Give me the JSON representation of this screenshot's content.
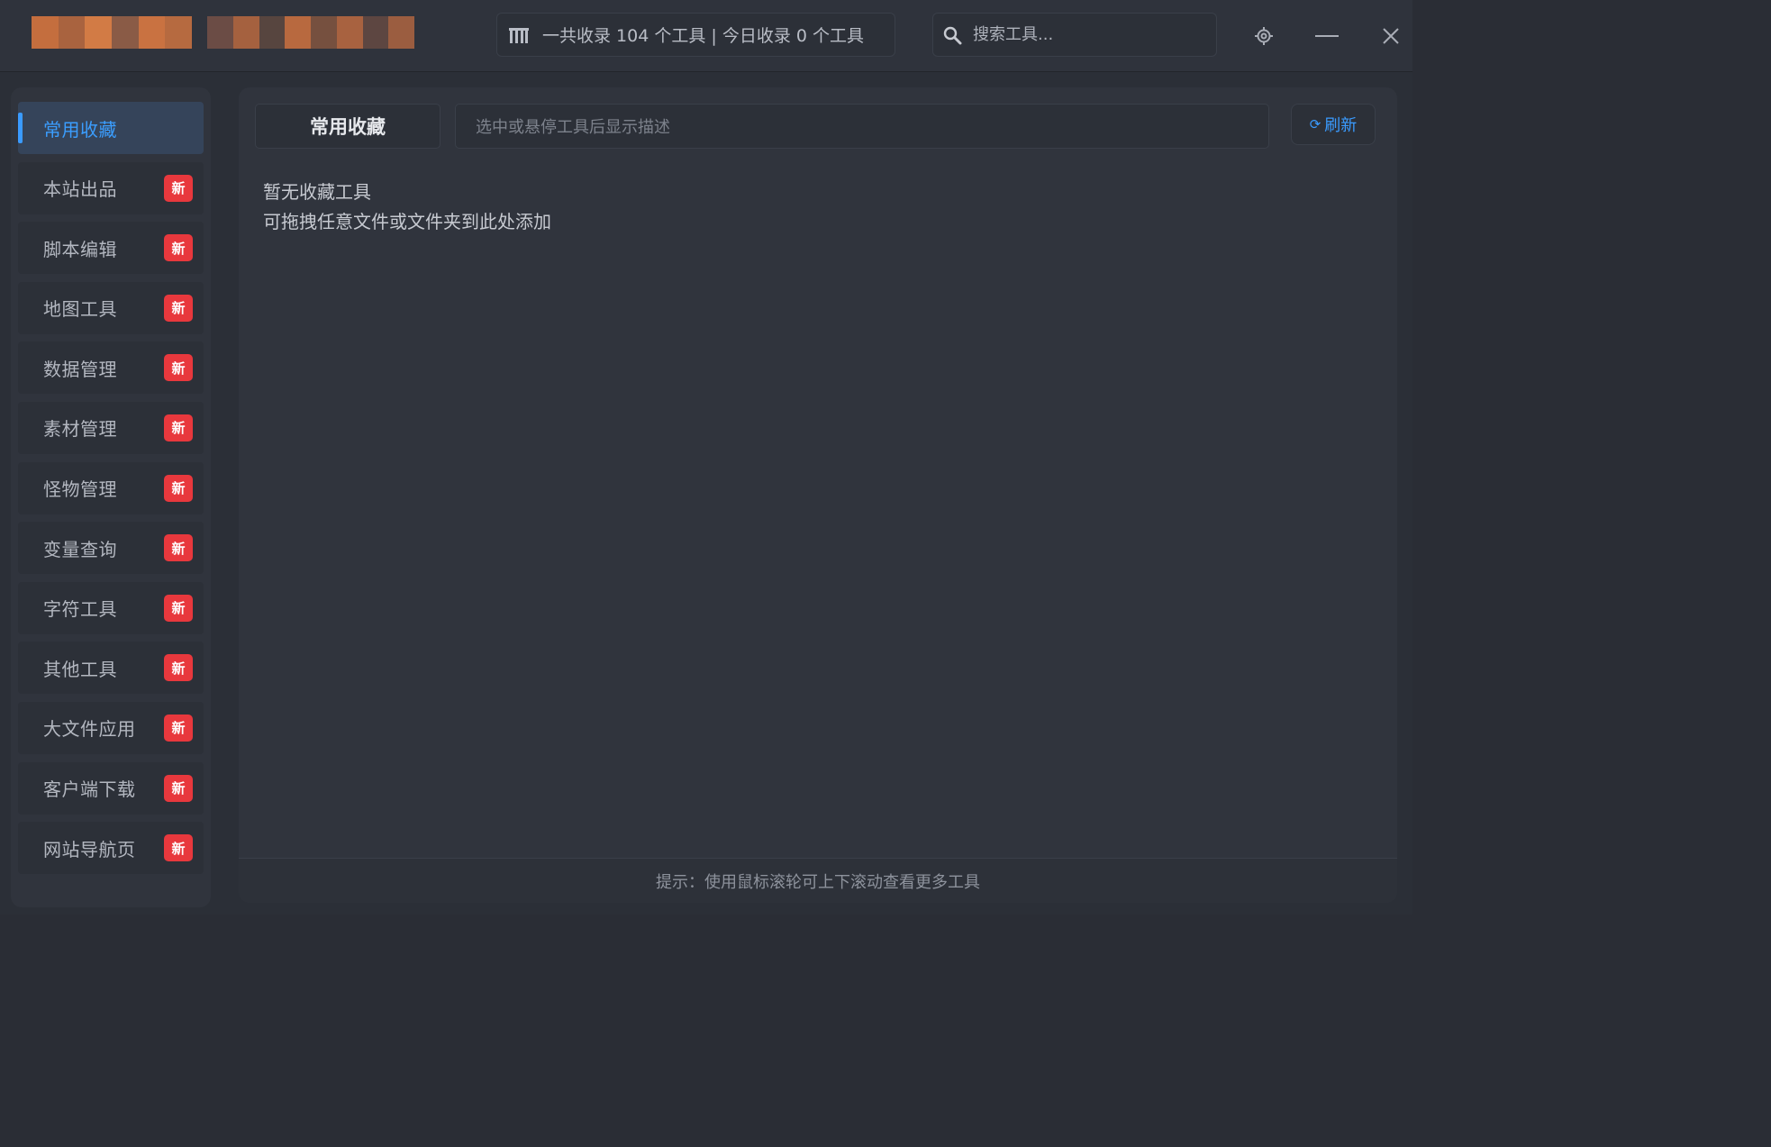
{
  "header": {
    "stats_text": "一共收录 104 个工具 | 今日收录 0 个工具",
    "search_placeholder": "搜索工具..."
  },
  "sidebar": {
    "items": [
      {
        "label": "常用收藏",
        "active": true,
        "badge": ""
      },
      {
        "label": "本站出品",
        "badge": "新"
      },
      {
        "label": "脚本编辑",
        "badge": "新"
      },
      {
        "label": "地图工具",
        "badge": "新"
      },
      {
        "label": "数据管理",
        "badge": "新"
      },
      {
        "label": "素材管理",
        "badge": "新"
      },
      {
        "label": "怪物管理",
        "badge": "新"
      },
      {
        "label": "变量查询",
        "badge": "新"
      },
      {
        "label": "字符工具",
        "badge": "新"
      },
      {
        "label": "其他工具",
        "badge": "新"
      },
      {
        "label": "大文件应用",
        "badge": "新"
      },
      {
        "label": "客户端下载",
        "badge": "新"
      },
      {
        "label": "网站导航页",
        "badge": "新"
      }
    ]
  },
  "main": {
    "tab_title": "常用收藏",
    "desc_placeholder": "选中或悬停工具后显示描述",
    "refresh_label": "刷新",
    "empty_line1": "暂无收藏工具",
    "empty_line2": "可拖拽任意文件或文件夹到此处添加",
    "hint": "提示：使用鼠标滚轮可上下滚动查看更多工具"
  },
  "colors": {
    "accent": "#3a9bff",
    "badge": "#e8383d",
    "background": "#2b2f37"
  }
}
